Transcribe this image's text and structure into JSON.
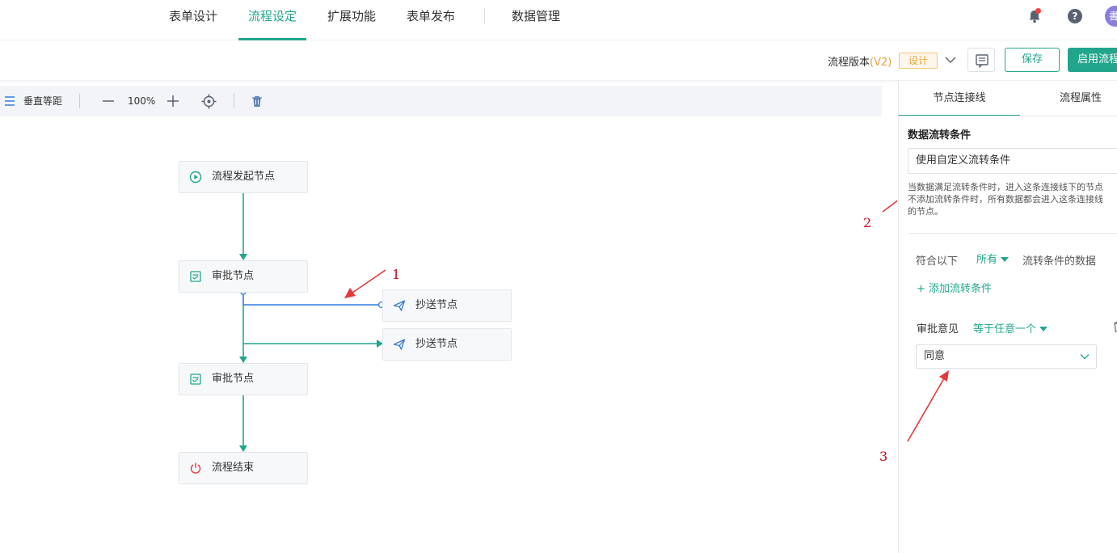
{
  "nav": {
    "tabs": [
      {
        "label": "表单设计"
      },
      {
        "label": "流程设定"
      },
      {
        "label": "扩展功能"
      },
      {
        "label": "表单发布"
      },
      {
        "label": "数据管理"
      }
    ],
    "help_glyph": "?",
    "avatar_text": "書"
  },
  "subheader": {
    "version_label": "流程版本",
    "version_value": "(V2)",
    "design_tag": "设计",
    "save_label": "保存",
    "enable_label": "启用流程"
  },
  "toolbar": {
    "layout_label": "垂直等距",
    "zoom": "100%"
  },
  "nodes": {
    "start": "流程发起节点",
    "approve1": "审批节点",
    "cc1": "抄送节点",
    "cc2": "抄送节点",
    "approve2": "审批节点",
    "end": "流程结束"
  },
  "panel": {
    "tabs": [
      {
        "label": "节点连接线"
      },
      {
        "label": "流程属性"
      }
    ],
    "section_title": "数据流转条件",
    "condition_mode": "使用自定义流转条件",
    "hint_lines": [
      "当数据满足流转条件时，进入这条连接线下的节点",
      "不添加流转条件时，所有数据都会进入这条连接线",
      "的节点。"
    ],
    "rule_prefix": "符合以下",
    "rule_match": "所有",
    "rule_suffix": "流转条件的数据",
    "add_condition": "+ 添加流转条件",
    "condition": {
      "field": "审批意见",
      "operator": "等于任意一个",
      "value": "同意"
    }
  },
  "annotations": [
    "1",
    "2",
    "3"
  ],
  "colors": {
    "accent": "#21a68d",
    "selected_line": "#2f7fe0",
    "annotation": "#d0021b",
    "warning": "#e6a23c"
  }
}
